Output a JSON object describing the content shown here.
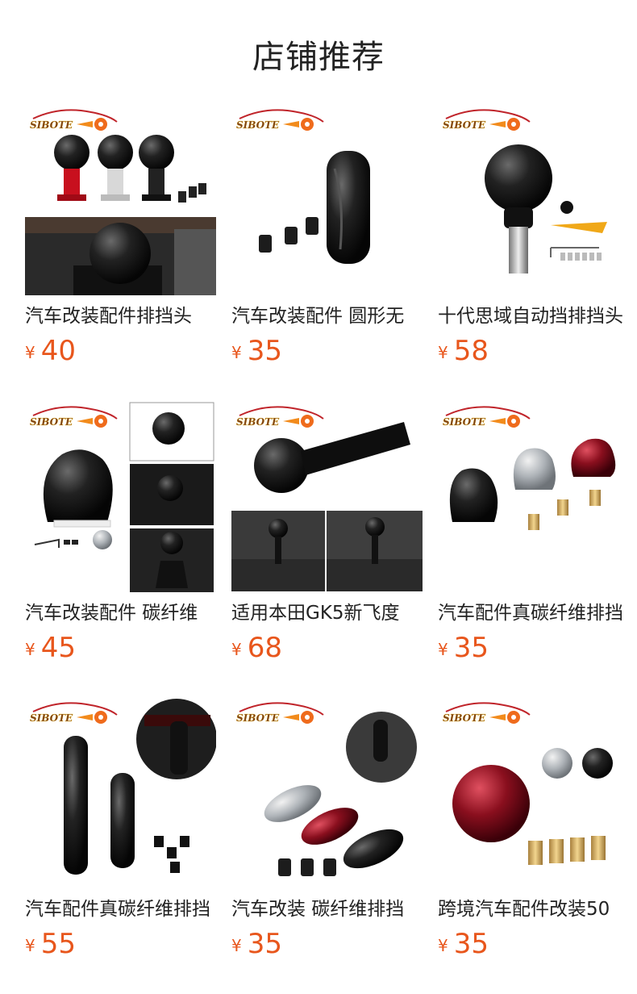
{
  "header": {
    "title": "店铺推荐"
  },
  "brand": {
    "logo_text": "SIBOTE",
    "accent": "#e8561c"
  },
  "products": [
    {
      "name": "汽车改装配件排挡头",
      "currency": "¥",
      "price": "40"
    },
    {
      "name": "汽车改装配件 圆形无",
      "currency": "¥",
      "price": "35"
    },
    {
      "name": "十代思域自动挡排挡头",
      "currency": "¥",
      "price": "58"
    },
    {
      "name": "汽车改装配件 碳纤维",
      "currency": "¥",
      "price": "45"
    },
    {
      "name": "适用本田GK5新飞度",
      "currency": "¥",
      "price": "68"
    },
    {
      "name": "汽车配件真碳纤维排挡",
      "currency": "¥",
      "price": "35"
    },
    {
      "name": "汽车配件真碳纤维排挡",
      "currency": "¥",
      "price": "55"
    },
    {
      "name": "汽车改装 碳纤维排挡",
      "currency": "¥",
      "price": "35"
    },
    {
      "name": "跨境汽车配件改装50",
      "currency": "¥",
      "price": "35"
    }
  ]
}
